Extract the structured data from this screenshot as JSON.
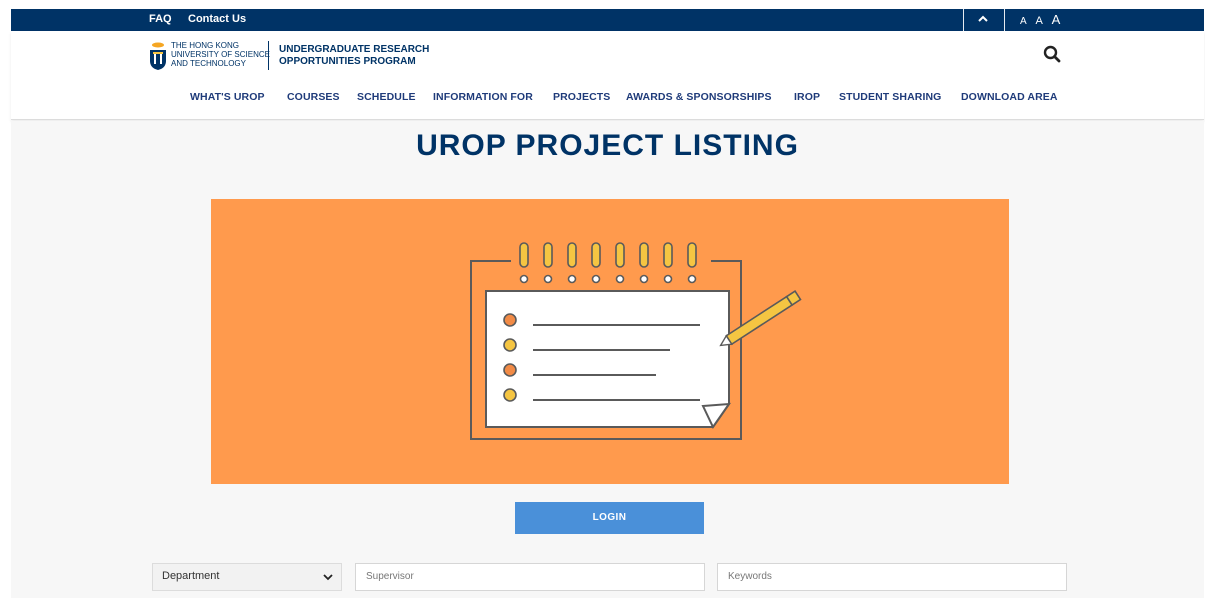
{
  "topbar": {
    "faq": "FAQ",
    "contact": "Contact Us",
    "font_sizes": [
      "A",
      "A",
      "A"
    ]
  },
  "header": {
    "university_lines": [
      "THE HONG KONG",
      "UNIVERSITY OF SCIENCE",
      "AND TECHNOLOGY"
    ],
    "program_lines": [
      "UNDERGRADUATE RESEARCH",
      "OPPORTUNITIES PROGRAM"
    ],
    "nav": [
      "WHAT'S UROP",
      "COURSES",
      "SCHEDULE",
      "INFORMATION FOR",
      "PROJECTS",
      "AWARDS & SPONSORSHIPS",
      "IROP",
      "STUDENT SHARING",
      "DOWNLOAD AREA"
    ]
  },
  "main": {
    "title": "UROP PROJECT LISTING",
    "login_label": "LOGIN",
    "filters": {
      "department_value": "Department",
      "supervisor_placeholder": "Supervisor",
      "keywords_placeholder": "Keywords"
    }
  },
  "colors": {
    "navy": "#003366",
    "nav_text": "#1f3b7a",
    "banner_orange": "#ff9a4d",
    "login_blue": "#4a90d9",
    "spiral_yellow": "#f5c542"
  },
  "icons": {
    "scroll_top": "chevron-up-icon",
    "search": "search-icon",
    "dropdown": "chevron-down-icon",
    "logo": "hkust-emblem-icon",
    "banner": "notepad-checklist-pencil-icon"
  }
}
